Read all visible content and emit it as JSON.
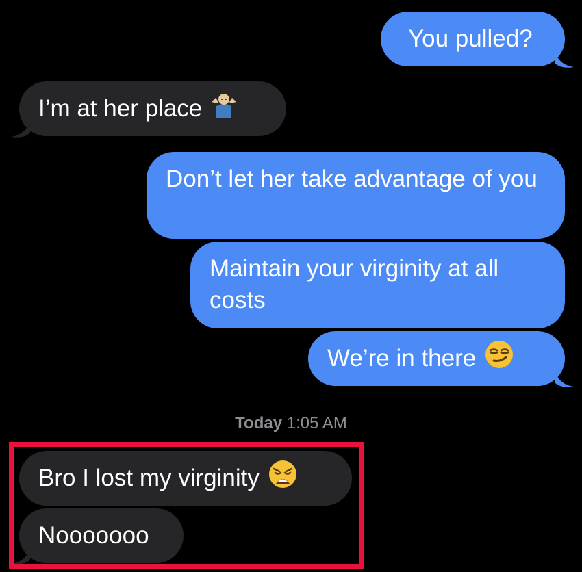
{
  "conversation": {
    "messages": [
      {
        "direction": "outgoing",
        "text": "You pulled?"
      },
      {
        "direction": "incoming",
        "text": "I’m at her place",
        "emoji": "person-shrugging-emoji"
      },
      {
        "direction": "outgoing",
        "text": "Don’t let her take advantage of you"
      },
      {
        "direction": "outgoing",
        "text": "Maintain your virginity at all costs"
      },
      {
        "direction": "outgoing",
        "text": "We’re in there",
        "emoji": "smirking-face-emoji"
      },
      {
        "direction": "incoming",
        "text": "Bro I lost my virginity",
        "emoji": "weary-face-emoji"
      },
      {
        "direction": "incoming",
        "text": "Nooooooo"
      }
    ],
    "timestamp": {
      "day": "Today",
      "time": "1:05 AM"
    }
  },
  "colors": {
    "background": "#000000",
    "outgoing_bubble": "#4c8bf5",
    "incoming_bubble": "#262628",
    "timestamp_text": "#8e8e93",
    "highlight_border": "#e8133d"
  }
}
